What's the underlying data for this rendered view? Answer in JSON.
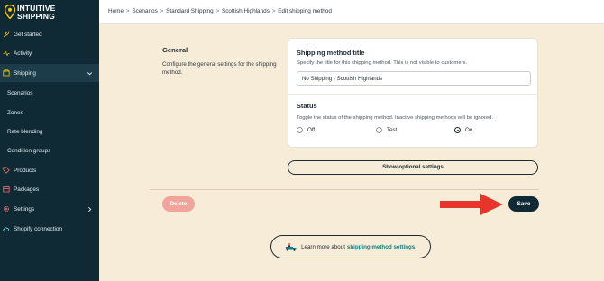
{
  "brand": {
    "line1": "INTUITIVE",
    "line2": "SHIPPING"
  },
  "sidebar": {
    "items": [
      {
        "label": "Get started",
        "icon": "rocket-icon"
      },
      {
        "label": "Activity",
        "icon": "activity-icon"
      },
      {
        "label": "Shipping",
        "icon": "box-icon",
        "expanded": true
      },
      {
        "label": "Scenarios"
      },
      {
        "label": "Zones"
      },
      {
        "label": "Rate blending"
      },
      {
        "label": "Condition groups"
      },
      {
        "label": "Products",
        "icon": "tag-icon"
      },
      {
        "label": "Packages",
        "icon": "package-icon"
      },
      {
        "label": "Settings",
        "icon": "gear-icon"
      },
      {
        "label": "Shopify connection",
        "icon": "cloud-icon"
      }
    ]
  },
  "breadcrumb": {
    "items": [
      "Home",
      "Scenarios",
      "Standard Shipping",
      "Scottish Highlands",
      "Edit shipping method"
    ],
    "separator": ">"
  },
  "general": {
    "heading": "General",
    "description": "Configure the general settings for the shipping method."
  },
  "title_field": {
    "label": "Shipping method title",
    "help": "Specify the title for this shipping method. This is not visible to customers.",
    "value": "No Shipping - Scottish Highlands"
  },
  "status": {
    "label": "Status",
    "help": "Toggle the status of the shipping method. Inactive shipping methods will be ignored.",
    "options": [
      {
        "label": "Off",
        "checked": false
      },
      {
        "label": "Test",
        "checked": false
      },
      {
        "label": "On",
        "checked": true
      }
    ]
  },
  "buttons": {
    "optional": "Show optional settings",
    "delete": "Delete",
    "save": "Save"
  },
  "learn": {
    "prefix": "Learn more about",
    "link": "shipping method settings."
  },
  "colors": {
    "sidebar_bg": "#0f2a35",
    "page_bg": "#f7ecd8",
    "save_bg": "#0f2a35",
    "delete_bg": "#f0a49b",
    "arrow": "#e8342a",
    "link": "#0f7c89",
    "brand_pin": "#f5c518"
  }
}
